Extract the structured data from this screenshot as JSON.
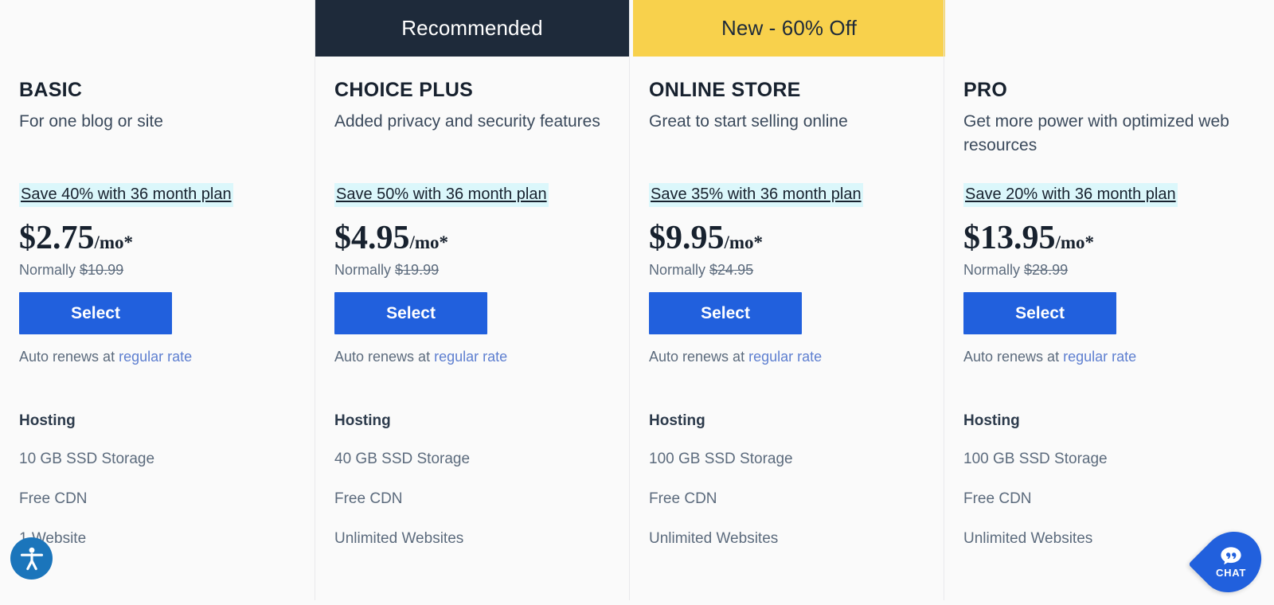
{
  "banners": [
    {
      "id": "recommended",
      "label": "Recommended",
      "bg": "#1e2a3a",
      "color": "#ffffff"
    },
    {
      "id": "new-discount",
      "label": "New - 60% Off",
      "bg": "#f8d14c",
      "color": "#1e2a3a"
    }
  ],
  "common": {
    "normally_prefix": "Normally",
    "select_label": "Select",
    "auto_renew_prefix": "Auto renews at ",
    "auto_renew_link": "regular rate",
    "features_title": "Hosting"
  },
  "plans": [
    {
      "name": "BASIC",
      "description": "For one blog or site",
      "save_badge": "Save 40% with 36 month plan",
      "price": "$2.75",
      "price_suffix": "/mo*",
      "normally_price": "$10.99",
      "features": [
        "10 GB SSD Storage",
        "Free CDN",
        "1 Website"
      ]
    },
    {
      "name": "CHOICE PLUS",
      "description": "Added privacy and security features",
      "save_badge": "Save 50% with 36 month plan",
      "price": "$4.95",
      "price_suffix": "/mo*",
      "normally_price": "$19.99",
      "features": [
        "40 GB SSD Storage",
        "Free CDN",
        "Unlimited Websites"
      ]
    },
    {
      "name": "ONLINE STORE",
      "description": "Great to start selling online",
      "save_badge": "Save 35% with 36 month plan",
      "price": "$9.95",
      "price_suffix": "/mo*",
      "normally_price": "$24.95",
      "features": [
        "100 GB SSD Storage",
        "Free CDN",
        "Unlimited Websites"
      ]
    },
    {
      "name": "PRO",
      "description": "Get more power with optimized web resources",
      "save_badge": "Save 20% with 36 month plan",
      "price": "$13.95",
      "price_suffix": "/mo*",
      "normally_price": "$28.99",
      "features": [
        "100 GB SSD Storage",
        "Free CDN",
        "Unlimited Websites"
      ]
    }
  ],
  "widgets": {
    "accessibility_icon": "accessibility-person-icon",
    "chat_icon": "speech-bubble-icon",
    "chat_label": "CHAT"
  },
  "colors": {
    "accent_blue": "#2160dd",
    "banner_dark": "#1e2a3a",
    "banner_yellow": "#f8d14c",
    "save_highlight": "#dbf7fb",
    "link_blue": "#5e7fd0",
    "page_bg": "#fafafa"
  }
}
